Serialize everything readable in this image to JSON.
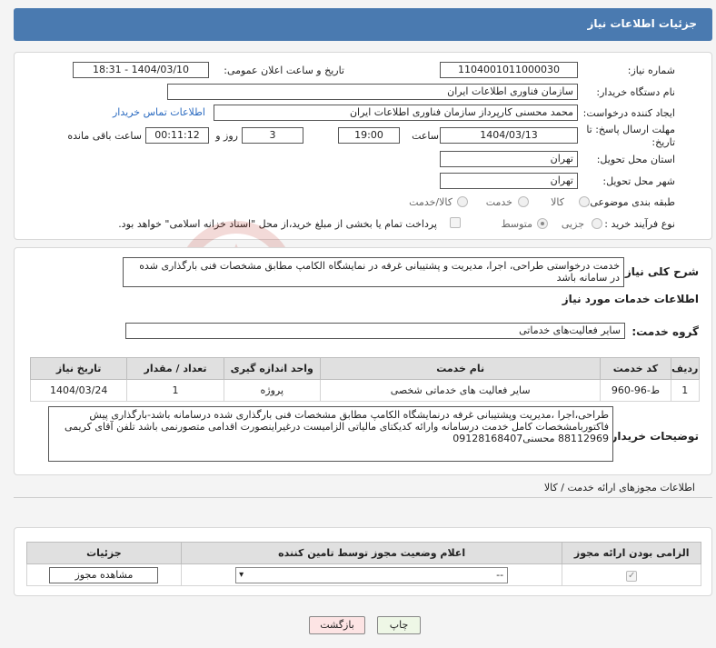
{
  "header": {
    "title": "جزئیات اطلاعات نیاز"
  },
  "fields": {
    "need_number_label": "شماره نیاز:",
    "need_number": "1104001011000030",
    "announce_label": "تاریخ و ساعت اعلان عمومی:",
    "announce_value": "1404/03/10 - 18:31",
    "buyer_org_label": "نام دستگاه خریدار:",
    "buyer_org": "سازمان فناوری اطلاعات ایران",
    "requester_label": "ایجاد کننده درخواست:",
    "requester": "محمد محسنی کارپرداز سازمان فناوری اطلاعات ایران",
    "contact_link": "اطلاعات تماس خریدار",
    "deadline_label_1": "مهلت ارسال پاسخ: تا",
    "deadline_label_2": "تاریخ:",
    "deadline_date": "1404/03/13",
    "time_label": "ساعت",
    "deadline_time": "19:00",
    "days_value": "3",
    "days_label": "روز و",
    "remaining_time": "00:11:12",
    "remaining_label": "ساعت باقی مانده",
    "province_label": "استان محل تحویل:",
    "province": "تهران",
    "city_label": "شهر محل تحویل:",
    "city": "تهران",
    "category_label": "طبقه بندی موضوعی:",
    "category_options": [
      "کالا",
      "خدمت",
      "کالا/خدمت"
    ],
    "purchase_type_label": "نوع فرآیند خرید :",
    "purchase_type_options": [
      "جزیی",
      "متوسط"
    ],
    "payment_note": "پرداخت تمام یا بخشی از مبلغ خرید،از محل \"اسناد خزانه اسلامی\" خواهد بود."
  },
  "description": {
    "label": "شرح کلی نیاز:",
    "text": "خدمت درخواستی طراحی، اجرا، مدیریت و پشتیبانی غرفه در نمایشگاه الکامپ مطابق مشخصات فنی بارگذاری شده در سامانه باشد"
  },
  "services": {
    "section_title": "اطلاعات خدمات مورد نیاز",
    "group_label": "گروه خدمت:",
    "group_value": "سایر فعالیت‌های خدماتی",
    "columns": [
      "ردیف",
      "کد خدمت",
      "نام خدمت",
      "واحد اندازه گیری",
      "تعداد / مقدار",
      "تاریخ نیاز"
    ],
    "rows": [
      [
        "1",
        "ط-96-960",
        "سایر فعالیت های خدماتی شخصی",
        "پروژه",
        "1",
        "1404/03/24"
      ]
    ]
  },
  "buyer_notes": {
    "label": "توضیحات خریدار:",
    "text": "طراحی،اجرا ،مدیریت وپشتیبانی غرفه درنمایشگاه الکامپ مطابق مشخصات فنی بارگذاری شده درسامانه باشد-بارگذاری پیش فاکتوربامشخصات کامل خدمت درسامانه وارائه کدیکتای مالیاتی الزامیست درغیراینصورت اقدامی متصورنمی باشد تلفن آقای کریمی 88112969 محسنی09128168407"
  },
  "permits": {
    "section_title": "اطلاعات مجوزهای ارائه خدمت / کالا",
    "columns": [
      "الزامی بودن ارائه مجوز",
      "اعلام وضعیت مجوز توسط تامین کننده",
      "جزئیات"
    ],
    "select_value": "--",
    "view_button": "مشاهده مجوز"
  },
  "buttons": {
    "print": "چاپ",
    "back": "بازگشت"
  },
  "watermark": {
    "text": "AriaTender.neT"
  },
  "colors": {
    "header_bg": "#4a7ab0",
    "link": "#2a6ac0",
    "back_bg": "#fde4e4",
    "print_bg": "#eef7e6"
  }
}
